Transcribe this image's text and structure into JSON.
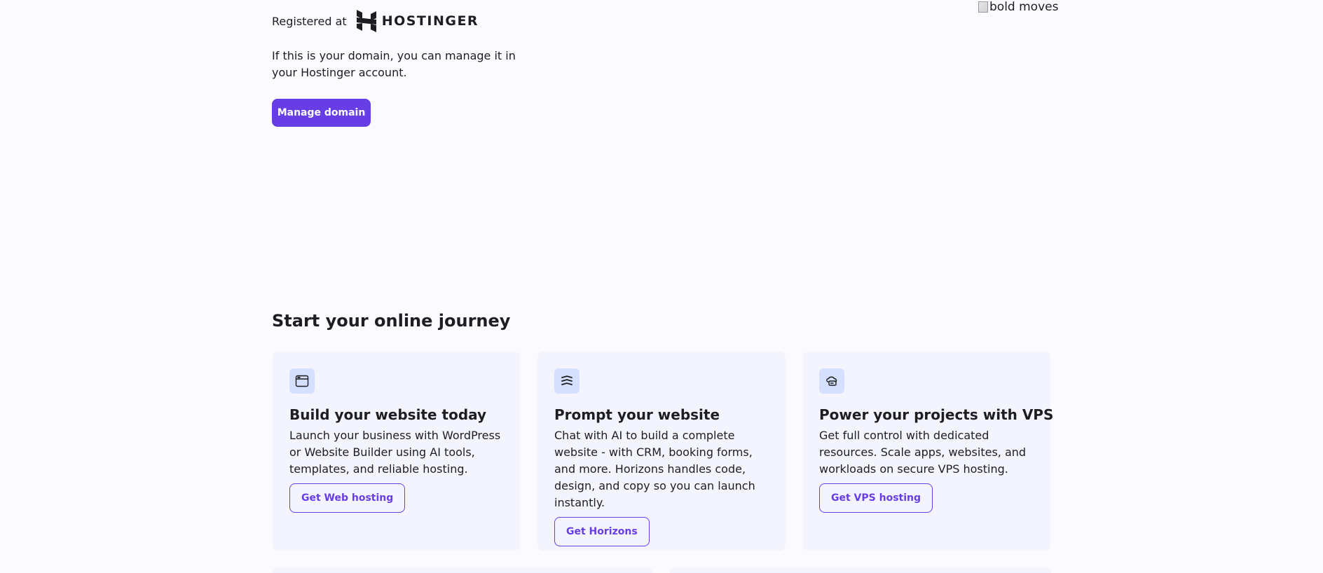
{
  "registrar": {
    "label": "Registered at",
    "brand": "HOSTINGER",
    "icon": "hostinger-logo-icon"
  },
  "domain_info": {
    "text": "If this is your domain, you can manage it in your Hostinger account.",
    "manage_button": "Manage domain"
  },
  "hero_image": {
    "alt": "bold moves"
  },
  "journey": {
    "title": "Start your online journey",
    "cards": [
      {
        "icon": "browser-window-icon",
        "title": "Build your website today",
        "description": "Launch your business with WordPress or Website Builder using AI tools, templates, and reliable hosting.",
        "button": "Get Web hosting"
      },
      {
        "icon": "horizons-waves-icon",
        "title": "Prompt your website",
        "description": "Chat with AI to build a complete website - with CRM, booking forms, and more. Horizons handles code, design, and copy so you can launch instantly.",
        "button": "Get Horizons"
      },
      {
        "icon": "cloud-server-icon",
        "title": "Power your projects with VPS",
        "description": "Get full control with dedicated resources. Scale apps, websites, and workloads on secure VPS hosting.",
        "button": "Get VPS hosting"
      }
    ]
  },
  "colors": {
    "accent": "#673de6",
    "background": "#fafaff",
    "card_background": "#f4f4ff",
    "icon_background": "#d5dfff"
  }
}
